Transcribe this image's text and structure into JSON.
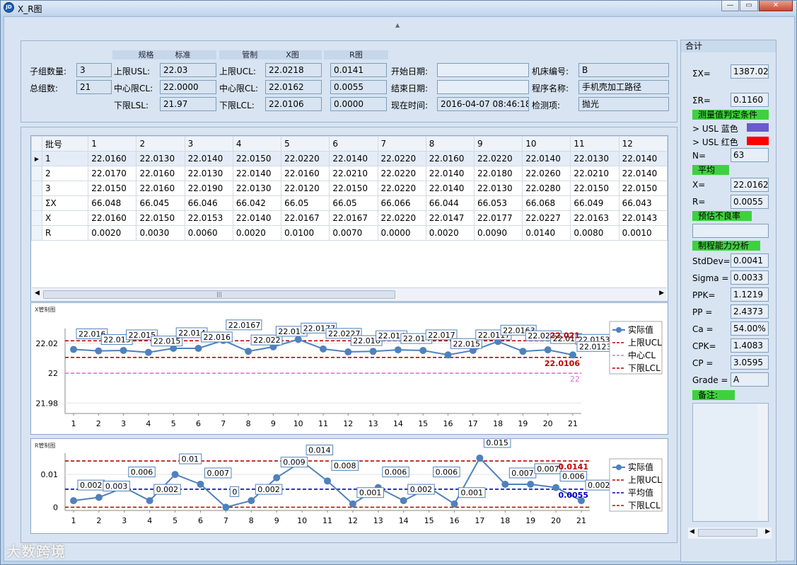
{
  "window": {
    "title": "X_R图",
    "icon_text": "JD"
  },
  "params": {
    "headers": {
      "spec": "规格",
      "standard": "标准",
      "control": "管制",
      "x_chart": "X图",
      "r_chart": "R图"
    },
    "subgroup_count_label": "子组数量:",
    "subgroup_count": "3",
    "total_groups_label": "总组数:",
    "total_groups": "21",
    "usl_label": "上限USL:",
    "usl": "22.03",
    "cl_label": "中心限CL:",
    "cl": "22.0000",
    "lsl_label": "下限LSL:",
    "lsl": "21.97",
    "ucl_label": "上限UCL:",
    "x_ucl": "22.0218",
    "r_ucl": "0.0141",
    "ccl_label": "中心限CL:",
    "x_cl": "22.0162",
    "r_cl": "0.0055",
    "lcl_label": "下限LCL:",
    "x_lcl": "22.0106",
    "r_lcl": "0.0000",
    "start_date_label": "开始日期:",
    "start_date": "",
    "end_date_label": "结束日期:",
    "end_date": "",
    "now_label": "现在时间:",
    "now": "2016-04-07 08:46:18",
    "machine_label": "机床编号:",
    "machine": "B",
    "program_label": "程序名称:",
    "program": "手机壳加工路径",
    "inspect_label": "检测项:",
    "inspect": "抛光"
  },
  "grid": {
    "columns": [
      "批号",
      "1",
      "2",
      "3",
      "4",
      "5",
      "6",
      "7",
      "8",
      "9",
      "10",
      "11",
      "12"
    ],
    "rows": [
      [
        "1",
        "22.0160",
        "22.0130",
        "22.0140",
        "22.0150",
        "22.0220",
        "22.0140",
        "22.0220",
        "22.0160",
        "22.0220",
        "22.0140",
        "22.0130",
        "22.0140"
      ],
      [
        "2",
        "22.0170",
        "22.0160",
        "22.0130",
        "22.0140",
        "22.0160",
        "22.0210",
        "22.0220",
        "22.0140",
        "22.0180",
        "22.0260",
        "22.0210",
        "22.0140"
      ],
      [
        "3",
        "22.0150",
        "22.0160",
        "22.0190",
        "22.0130",
        "22.0120",
        "22.0150",
        "22.0220",
        "22.0140",
        "22.0130",
        "22.0280",
        "22.0150",
        "22.0150"
      ],
      [
        "ΣX",
        "66.048",
        "66.045",
        "66.046",
        "66.042",
        "66.05",
        "66.05",
        "66.066",
        "66.044",
        "66.053",
        "66.068",
        "66.049",
        "66.043"
      ],
      [
        "X",
        "22.0160",
        "22.0150",
        "22.0153",
        "22.0140",
        "22.0167",
        "22.0167",
        "22.0220",
        "22.0147",
        "22.0177",
        "22.0227",
        "22.0163",
        "22.0143"
      ],
      [
        "R",
        "0.0020",
        "0.0030",
        "0.0060",
        "0.0020",
        "0.0100",
        "0.0070",
        "0.0000",
        "0.0020",
        "0.0090",
        "0.0140",
        "0.0080",
        "0.0010"
      ]
    ]
  },
  "x_chart": {
    "title": "X管制图"
  },
  "r_chart": {
    "title": "R管制图"
  },
  "chart_data": [
    {
      "type": "line",
      "title": "X管制图",
      "x": [
        1,
        2,
        3,
        4,
        5,
        6,
        7,
        8,
        9,
        10,
        11,
        12,
        13,
        14,
        15,
        16,
        17,
        18,
        19,
        20,
        21
      ],
      "yticks": [
        "21.98",
        "22",
        "22.02"
      ],
      "ylim": [
        21.973,
        22.03
      ],
      "series": [
        {
          "name": "实际值",
          "color": "#4f81bd",
          "values": [
            22.016,
            22.015,
            22.0153,
            22.014,
            22.0167,
            22.0167,
            22.022,
            22.0147,
            22.0177,
            22.0227,
            22.0163,
            22.0143,
            22.0147,
            22.0157,
            22.0153,
            22.0123,
            22.0153,
            22.0213,
            22.0147,
            22.0157,
            22.0123
          ]
        },
        {
          "name": "上限UCL",
          "color": "#c00000",
          "value": 22.0218
        },
        {
          "name": "中心CL",
          "color": "#e075d0",
          "value": 22.0
        },
        {
          "name": "下限LCL",
          "color": "#c00000",
          "value": 22.0106
        }
      ],
      "point_labels": [
        "22.016",
        "22.015",
        "22.015",
        "22.015",
        "22.014",
        "22.016",
        "22.0167",
        "22.022",
        "22.014",
        "22.0177",
        "22.0227",
        "22.016",
        "22.014",
        "22.014",
        "22.017",
        "22.015",
        "22.0117",
        "22.0163",
        "22.0213",
        "22.014",
        "22.0153"
      ],
      "last_label": "22.0123",
      "ref_labels": {
        "ucl": "22.021",
        "lcl": "22.0106",
        "cl": "22"
      }
    },
    {
      "type": "line",
      "title": "R管制图",
      "x": [
        1,
        2,
        3,
        4,
        5,
        6,
        7,
        8,
        9,
        10,
        11,
        12,
        13,
        14,
        15,
        16,
        17,
        18,
        19,
        20,
        21
      ],
      "yticks": [
        "0",
        "0.01"
      ],
      "ylim": [
        -0.001,
        0.0165
      ],
      "series": [
        {
          "name": "实际值",
          "color": "#4f81bd",
          "values": [
            0.002,
            0.003,
            0.006,
            0.002,
            0.01,
            0.007,
            0.0,
            0.002,
            0.009,
            0.014,
            0.008,
            0.001,
            0.006,
            0.002,
            0.006,
            0.001,
            0.015,
            0.007,
            0.007,
            0.006,
            0.002
          ]
        },
        {
          "name": "上限UCL",
          "color": "#c00000",
          "value": 0.0141
        },
        {
          "name": "平均值",
          "color": "#0000c0",
          "value": 0.0055
        },
        {
          "name": "下限LCL",
          "color": "#c00000",
          "value": 0.0
        }
      ],
      "point_labels": [
        "0.002",
        "0.003",
        "0.006",
        "0.002",
        "0.01",
        "0.007",
        "0",
        "0.002",
        "0.009",
        "0.014",
        "0.008",
        "0.001",
        "0.006",
        "0.002",
        "0.006",
        "0.001",
        "0.015",
        "0.007",
        "0.007",
        "0.006",
        "0.002"
      ],
      "ref_labels": {
        "ucl": "0.0141",
        "avg": "0.0055"
      }
    }
  ],
  "summary": {
    "title": "合计",
    "sum_x_label": "ΣX=",
    "sum_x": "1387.02",
    "sum_r_label": "ΣR=",
    "sum_r": "0.1160",
    "cond_header": "测量值判定条件",
    "usl_blue_label": ">  USL  蓝色",
    "usl_red_label": ">  USL  红色",
    "blue": "#6a5acd",
    "red": "#ff0000",
    "n_label": "N=",
    "n": "63",
    "avg_header": "平均",
    "x_label": "X=",
    "x": "22.0162",
    "r_label": "R=",
    "r": "0.0055",
    "defect_header": "预估不良率",
    "defect": "",
    "cap_header": "制程能力分析",
    "stddev_label": "StdDev=",
    "stddev": "0.0041",
    "sigma_label": "Sigma  =",
    "sigma": "0.0033",
    "ppk_label": "PPK=",
    "ppk": "1.1219",
    "pp_label": "PP =",
    "pp": "2.4373",
    "ca_label": "Ca =",
    "ca": "54.00%",
    "cpk_label": "CPK=",
    "cpk": "1.4083",
    "cp_label": "CP =",
    "cp": "3.0595",
    "grade_label": "Grade =",
    "grade": "A",
    "notes_header": "备注:"
  },
  "watermark": "大数跨境"
}
